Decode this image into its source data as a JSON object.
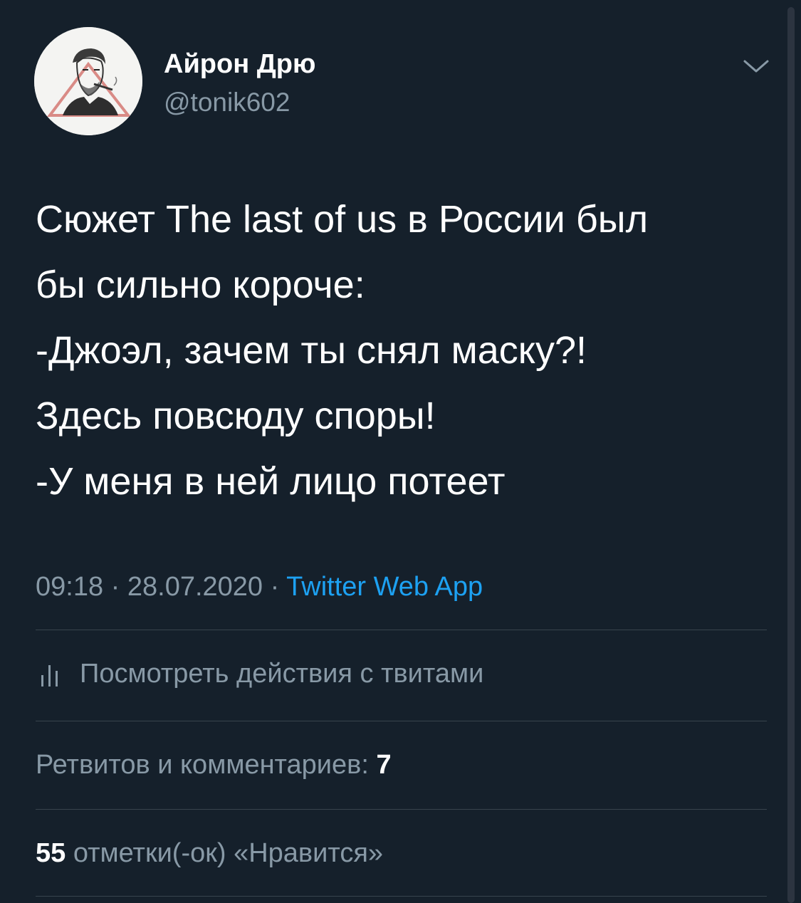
{
  "author": {
    "display_name": "Айрон Дрю",
    "username": "@tonik602",
    "avatar_icon": "sketch-portrait-avatar"
  },
  "tweet": {
    "lines": [
      "Сюжет The last of us в России был",
      "бы сильно короче:",
      "-Джоэл, зачем ты снял маску?!",
      "Здесь повсюду споры!",
      "-У меня в ней лицо потеет"
    ],
    "time": "09:18",
    "date": "28.07.2020",
    "separator": "·",
    "source": "Twitter Web App"
  },
  "activity": {
    "icon": "bar-chart-icon",
    "label": "Посмотреть действия с твитами"
  },
  "stats": {
    "retweets_label": "Ретвитов и комментариев:",
    "retweets_count": "7",
    "likes_count": "55",
    "likes_label": "отметки(-ок) «Нравится»"
  },
  "colors": {
    "background": "#15202b",
    "text": "#ffffff",
    "secondary": "#8899a6",
    "accent": "#1da1f2",
    "divider": "#38444d"
  }
}
